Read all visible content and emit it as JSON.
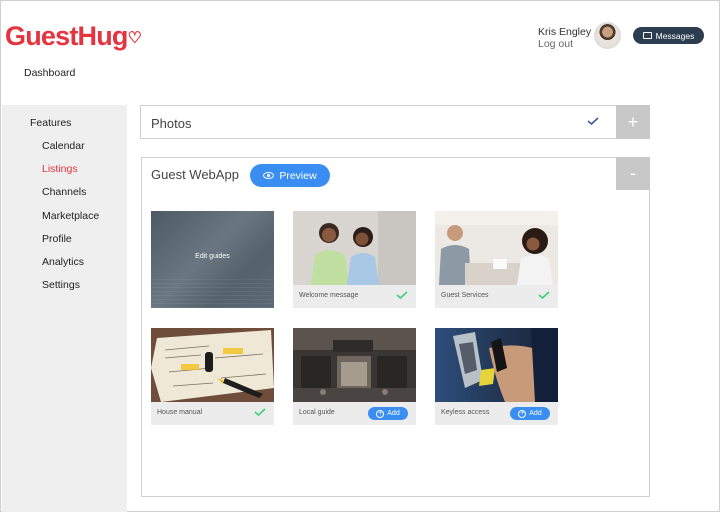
{
  "header": {
    "logo": "GuestHug",
    "dashboard": "Dashboard",
    "user_name": "Kris Engley",
    "logout": "Log out",
    "messages": "Messages"
  },
  "sidebar": {
    "items": [
      {
        "label": "Features"
      },
      {
        "label": "Calendar"
      },
      {
        "label": "Listings"
      },
      {
        "label": "Channels"
      },
      {
        "label": "Marketplace"
      },
      {
        "label": "Profile"
      },
      {
        "label": "Analytics"
      },
      {
        "label": "Settings"
      }
    ],
    "active": "Listings"
  },
  "photos_panel": {
    "title": "Photos",
    "toggle": "+"
  },
  "webapp_panel": {
    "title": "Guest WebApp",
    "preview": "Preview",
    "toggle": "-",
    "edit_guides": "Edit guides",
    "cards": [
      {
        "label": "Welcome message",
        "status": "done"
      },
      {
        "label": "Guest Services",
        "status": "done"
      },
      {
        "label": "House manual",
        "status": "done"
      },
      {
        "label": "Local guide",
        "status": "add",
        "button": "Add"
      },
      {
        "label": "Keyless access",
        "status": "add",
        "button": "Add"
      }
    ]
  },
  "colors": {
    "brand": "#e5333f",
    "accent": "#3a8ef2",
    "check_green": "#3ccf7b",
    "check_blue": "#3b5b9a",
    "dark_button": "#2b3d4f"
  },
  "icons": [
    "heart-icon",
    "message-icon",
    "check-icon",
    "plus-icon",
    "minus-icon",
    "eye-icon",
    "add-circle-icon"
  ]
}
